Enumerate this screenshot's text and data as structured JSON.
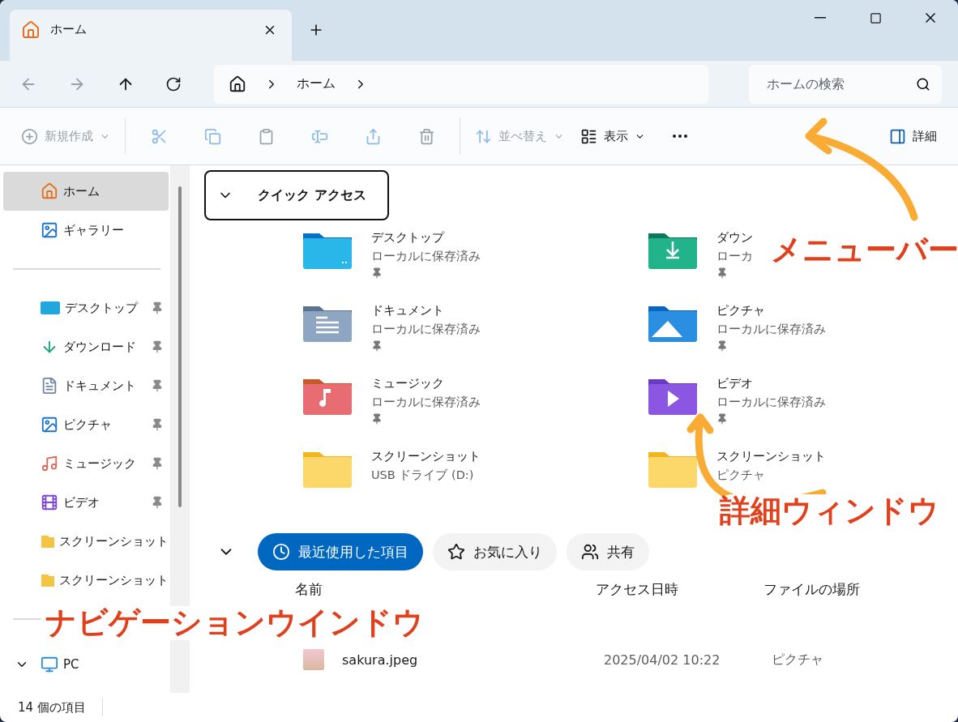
{
  "tabs": [
    {
      "label": "ホーム",
      "selected": true
    }
  ],
  "address": {
    "crumbs": [
      "ホーム"
    ]
  },
  "search": {
    "placeholder": "ホームの検索"
  },
  "toolbar": [
    {
      "kind": "new",
      "label": "新規作成",
      "disabled": true
    },
    {
      "kind": "cut",
      "disabled": true
    },
    {
      "kind": "copy",
      "disabled": true
    },
    {
      "kind": "paste",
      "disabled": true
    },
    {
      "kind": "rename",
      "disabled": true
    },
    {
      "kind": "share",
      "disabled": true
    },
    {
      "kind": "delete",
      "disabled": true
    },
    {
      "kind": "sort",
      "label": "並べ替え",
      "disabled": true
    },
    {
      "kind": "view",
      "label": "表示",
      "disabled": false
    },
    {
      "kind": "more",
      "disabled": false
    },
    {
      "kind": "details",
      "label": "詳細",
      "disabled": false
    }
  ],
  "sidebar": {
    "items": [
      {
        "kind": "home",
        "label": "ホーム",
        "selected": true,
        "pinned": false
      },
      {
        "kind": "gallery",
        "label": "ギャラリー",
        "selected": false,
        "pinned": false
      },
      {
        "kind": "divider"
      },
      {
        "kind": "desktop",
        "label": "デスクトップ",
        "selected": false,
        "pinned": true
      },
      {
        "kind": "download",
        "label": "ダウンロード",
        "selected": false,
        "pinned": true
      },
      {
        "kind": "document",
        "label": "ドキュメント",
        "selected": false,
        "pinned": true
      },
      {
        "kind": "picture",
        "label": "ピクチャ",
        "selected": false,
        "pinned": true
      },
      {
        "kind": "music",
        "label": "ミュージック",
        "selected": false,
        "pinned": true
      },
      {
        "kind": "video",
        "label": "ビデオ",
        "selected": false,
        "pinned": true
      },
      {
        "kind": "folder",
        "label": "スクリーンショット",
        "selected": false,
        "pinned": false
      },
      {
        "kind": "folder",
        "label": "スクリーンショット",
        "selected": false,
        "pinned": false
      },
      {
        "kind": "divider"
      },
      {
        "kind": "pc",
        "label": "PC",
        "selected": false,
        "pinned": false,
        "expanded": true
      }
    ]
  },
  "quick_access": {
    "title": "クイック アクセス",
    "expanded": true,
    "items": [
      {
        "kind": "desktop",
        "name": "デスクトップ",
        "sub": "ローカルに保存済み",
        "pinned": true
      },
      {
        "kind": "download",
        "name": "ダウン",
        "sub": "ローカ",
        "pinned": true
      },
      {
        "kind": "document",
        "name": "ドキュメント",
        "sub": "ローカルに保存済み",
        "pinned": true
      },
      {
        "kind": "picture",
        "name": "ピクチャ",
        "sub": "ローカルに保存済み",
        "pinned": true
      },
      {
        "kind": "music",
        "name": "ミュージック",
        "sub": "ローカルに保存済み",
        "pinned": true
      },
      {
        "kind": "video",
        "name": "ビデオ",
        "sub": "ローカルに保存済み",
        "pinned": true
      },
      {
        "kind": "folder",
        "name": "スクリーンショット",
        "sub": "USB ドライブ (D:)",
        "pinned": false
      },
      {
        "kind": "folder",
        "name": "スクリーンショット",
        "sub": "ピクチャ",
        "pinned": false
      }
    ]
  },
  "recent": {
    "expanded": true,
    "filters": [
      {
        "kind": "recent",
        "label": "最近使用した項目",
        "selected": true
      },
      {
        "kind": "favorite",
        "label": "お気に入り",
        "selected": false
      },
      {
        "kind": "shared",
        "label": "共有",
        "selected": false
      }
    ],
    "columns": [
      "名前",
      "アクセス日時",
      "ファイルの場所"
    ],
    "rows": [
      {
        "name": "sakura.jpeg",
        "accessed": "2025/04/02 10:22",
        "location": "ピクチャ"
      }
    ]
  },
  "status_bar": {
    "count": "14 個の項目"
  },
  "annotations": [
    {
      "kind": "menu",
      "text": "メニューバー"
    },
    {
      "kind": "details",
      "text": "詳細ウィンドウ"
    },
    {
      "kind": "nav",
      "text": "ナビゲーションウインドウ"
    }
  ]
}
